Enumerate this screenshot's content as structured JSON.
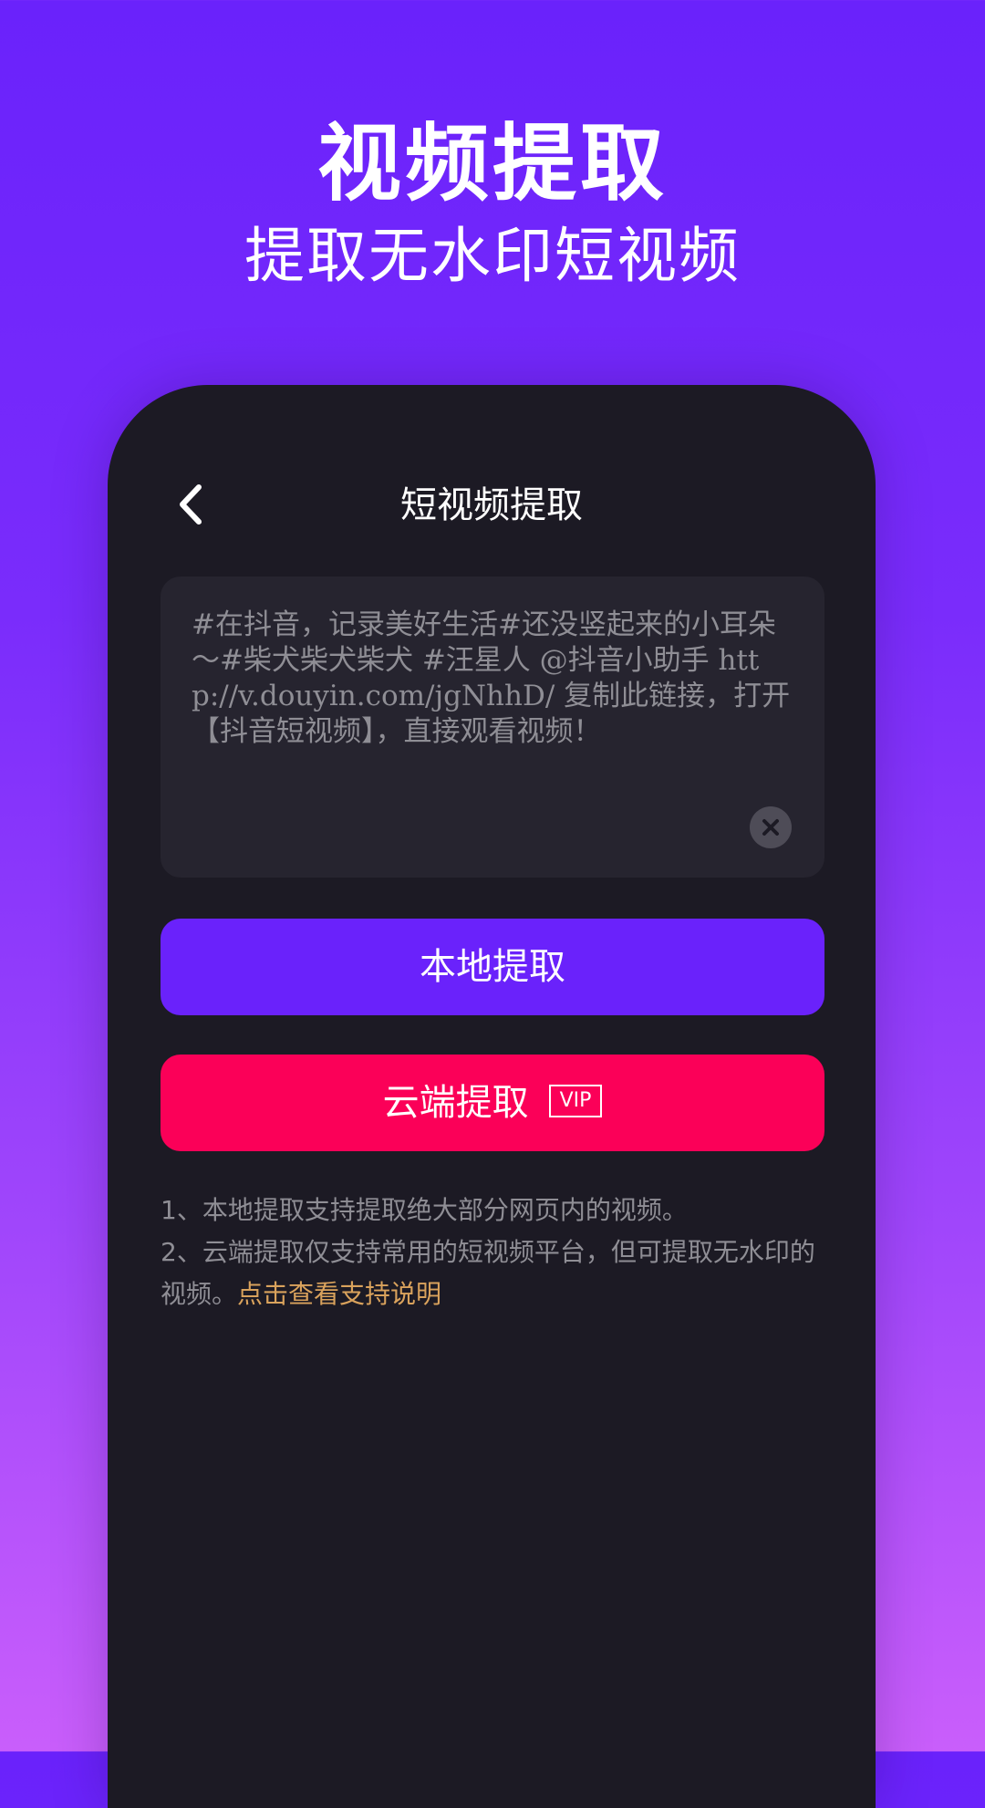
{
  "hero": {
    "title": "视频提取",
    "subtitle": "提取无水印短视频"
  },
  "nav": {
    "title": "短视频提取",
    "back_icon": "chevron-left-icon"
  },
  "input": {
    "value": "#在抖音，记录美好生活#还没竖起来的小耳朵～#柴犬柴犬柴犬 #汪星人 @抖音小助手 http://v.douyin.com/jgNhhD/ 复制此链接，打开【抖音短视频】，直接观看视频！",
    "clear_icon": "clear-circle-icon"
  },
  "buttons": {
    "local_label": "本地提取",
    "cloud_label": "云端提取",
    "vip_badge": "VIP"
  },
  "notes": {
    "line1": "1、本地提取支持提取绝大部分网页内的视频。",
    "line2": "2、云端提取仅支持常用的短视频平台，但可提取无水印的视频。",
    "link": "点击查看支持说明"
  },
  "colors": {
    "primary": "#6a22fb",
    "accent": "#fb0058",
    "link": "#d9a25c",
    "panel": "#1c1a24"
  }
}
